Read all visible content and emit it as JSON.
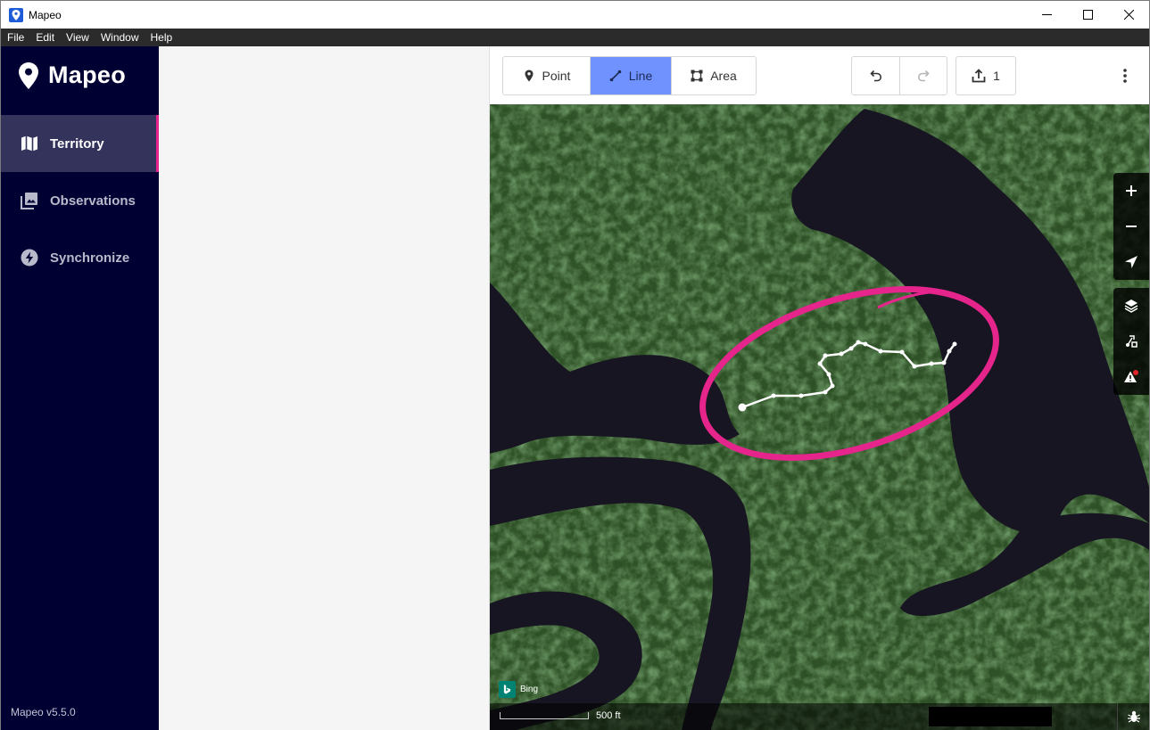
{
  "window": {
    "title": "Mapeo"
  },
  "menu": [
    "File",
    "Edit",
    "View",
    "Window",
    "Help"
  ],
  "brand": {
    "name": "Mapeo"
  },
  "nav": [
    {
      "label": "Territory",
      "icon": "map-icon",
      "active": true
    },
    {
      "label": "Observations",
      "icon": "photo-library-icon",
      "active": false
    },
    {
      "label": "Synchronize",
      "icon": "sync-bolt-icon",
      "active": false
    }
  ],
  "version": "Mapeo v5.5.0",
  "toolbar": {
    "modes": [
      {
        "label": "Point",
        "icon": "marker-icon",
        "active": false
      },
      {
        "label": "Line",
        "icon": "line-icon",
        "active": true
      },
      {
        "label": "Area",
        "icon": "area-icon",
        "active": false
      }
    ],
    "save_count": "1"
  },
  "map": {
    "attribution": "Bing",
    "scale_label": "500 ft"
  },
  "colors": {
    "sidebar_bg": "#000033",
    "active_nav_bg": "#33335c",
    "accent_pink": "#e5258c",
    "active_mode": "#7092ff"
  }
}
